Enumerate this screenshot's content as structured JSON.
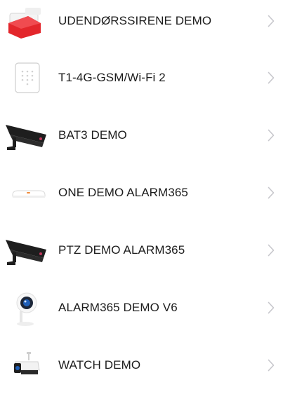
{
  "devices": [
    {
      "label": "UDENDØRSSIRENE DEMO",
      "icon": "siren-icon"
    },
    {
      "label": "T1-4G-GSM/Wi-Fi 2",
      "icon": "keypad-panel-icon"
    },
    {
      "label": "BAT3 DEMO",
      "icon": "security-camera-icon"
    },
    {
      "label": "ONE DEMO ALARM365",
      "icon": "alarm-hub-icon"
    },
    {
      "label": "PTZ DEMO ALARM365",
      "icon": "security-camera-icon"
    },
    {
      "label": "ALARM365 DEMO V6",
      "icon": "indoor-camera-icon"
    },
    {
      "label": "WATCH DEMO",
      "icon": "outdoor-camera-icon"
    }
  ],
  "colors": {
    "siren_red": "#e3262b",
    "camera_body": "#1e1e1e",
    "camera_lens": "#1f5fb8",
    "chevron": "#c7c7cc",
    "label_text": "#1c1c1c"
  }
}
